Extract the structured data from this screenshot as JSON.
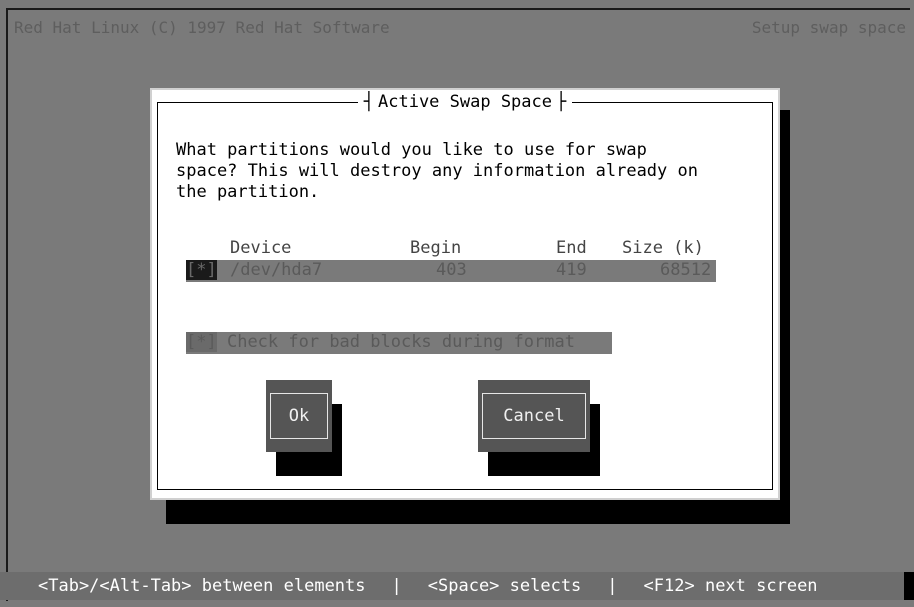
{
  "header": {
    "left_text": "Red Hat Linux (C) 1997 Red Hat Software",
    "right_text": "Setup swap space"
  },
  "dialog": {
    "title": "Active Swap Space",
    "question": "What partitions would you like to use for swap\nspace? This will destroy any information already on\nthe partition.",
    "table": {
      "columns": [
        "Device",
        "Begin",
        "End",
        "Size (k)"
      ],
      "rows": [
        {
          "checkbox": "[*]",
          "device": "/dev/hda7",
          "begin": "403",
          "end": "419",
          "size": "68512"
        }
      ]
    },
    "badblocks_checkbox": "[*]",
    "badblocks_label": "Check for bad blocks during format",
    "ok_label": "Ok",
    "cancel_label": "Cancel"
  },
  "statusbar": {
    "hint1": "<Tab>/<Alt-Tab> between elements",
    "sep": "|",
    "hint2": "<Space> selects",
    "hint3": "<F12> next screen"
  }
}
